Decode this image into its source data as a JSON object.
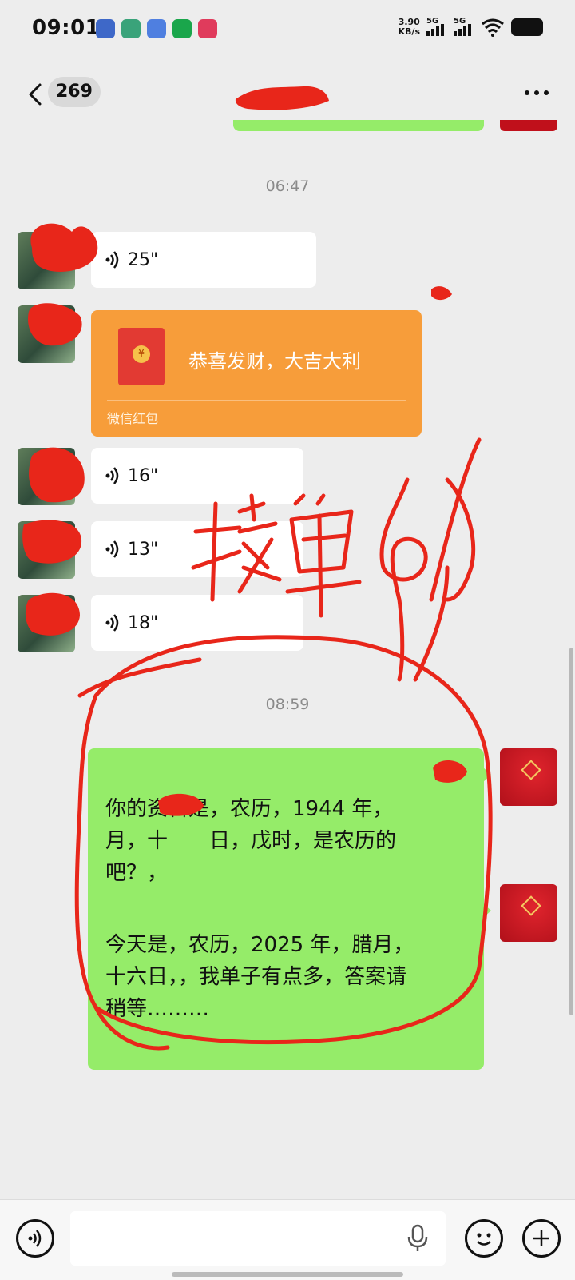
{
  "status_bar": {
    "time": "09:01",
    "net_speed_value": "3.90",
    "net_speed_unit": "KB/s",
    "sim1": "5G",
    "sim2": "5G",
    "app_icons": [
      "weather-icon",
      "app-icon",
      "app-icon",
      "music-icon",
      "video-icon"
    ]
  },
  "nav": {
    "unread_count": "269"
  },
  "chat": {
    "timestamps": [
      "06:47",
      "08:59"
    ],
    "voice_messages": [
      {
        "duration": "25\""
      },
      {
        "duration": "16\""
      },
      {
        "duration": "13\""
      },
      {
        "duration": "18\""
      }
    ],
    "red_packet": {
      "wish": "恭喜发财，大吉大利",
      "label": "微信红包"
    },
    "sent_messages": [
      {
        "text": "你的资料是，农历，1944 年，\n月，十　　日，戊时，是农历的\n吧？，"
      },
      {
        "text": "今天是，农历，2025 年，腊月，\n十六日，，我单子有点多，答案请\n稍等………"
      }
    ]
  },
  "colors": {
    "background": "#ededed",
    "sent_bubble": "#95ec69",
    "red_packet": "#f79d3a",
    "scribble": "#e8261a"
  }
}
